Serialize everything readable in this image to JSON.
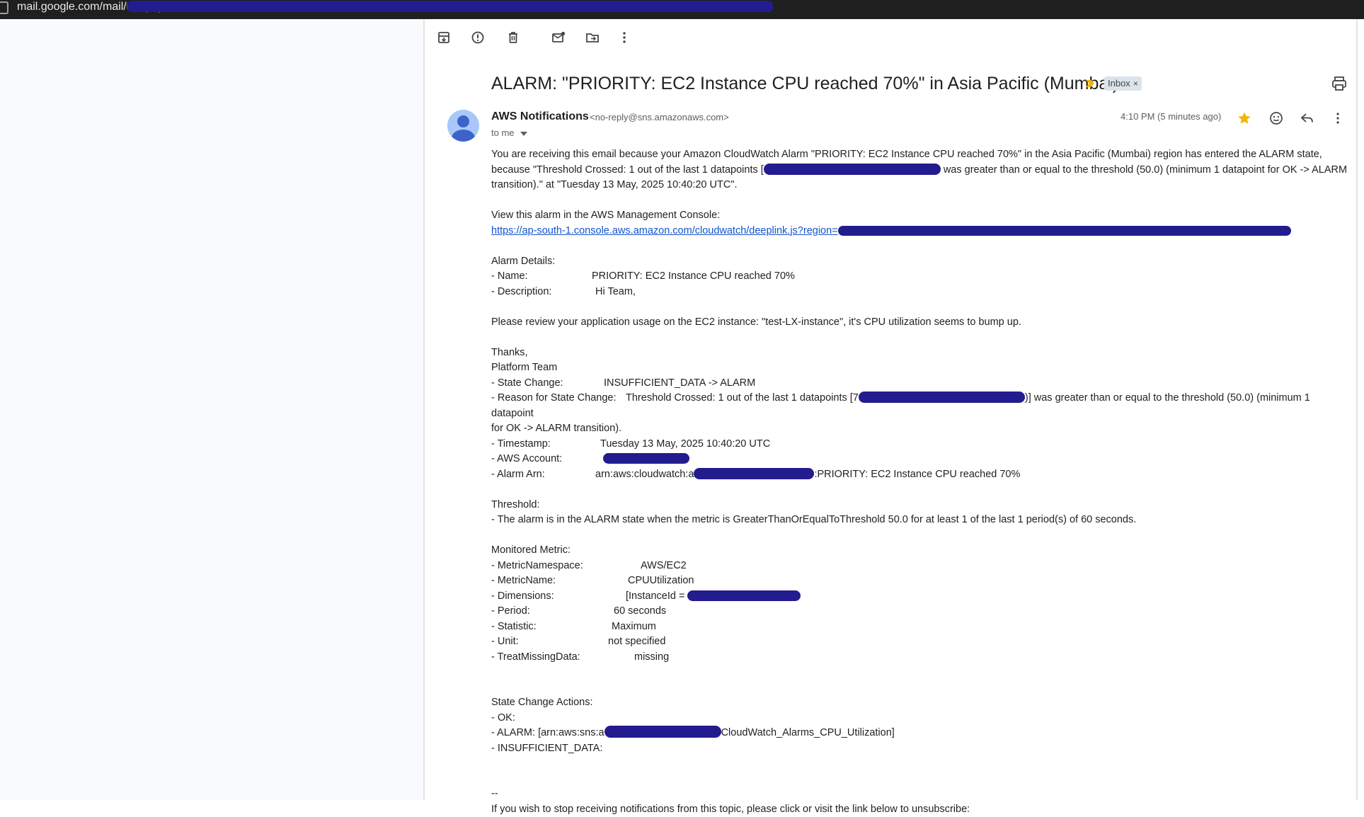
{
  "browser": {
    "url": "mail.google.com/mail/u/0/popout?ver=..."
  },
  "toolbar": {
    "archive": "archive-icon",
    "spam": "report-spam-icon",
    "delete": "delete-icon",
    "mark_unread": "mark-unread-icon",
    "move": "move-to-icon",
    "more": "more-vert-icon"
  },
  "email": {
    "subject": "ALARM: \"PRIORITY: EC2 Instance CPU reached 70%\" in Asia Pacific (Mumbai)",
    "label": "Inbox",
    "label_close": "×",
    "sender_name": "AWS Notifications",
    "sender_email": "<no-reply@sns.amazonaws.com>",
    "to": "to me",
    "time": "4:10 PM (5 minutes ago)",
    "colors": {
      "star": "#f4b400",
      "important": "#f4b400",
      "link": "#1155cc",
      "redaction": "#231c8e"
    }
  },
  "body": {
    "intro_1": "You are receiving this email because your Amazon CloudWatch Alarm \"PRIORITY: EC2 Instance CPU reached 70%\" in the Asia Pacific (Mumbai) region has entered the ALARM state,",
    "intro_2a": "because \"Threshold Crossed: 1 out of the last 1 datapoints [",
    "intro_2b": " was greater than or equal to the threshold (50.0) (minimum 1 datapoint for OK -> ALARM",
    "intro_3": "transition).\" at \"Tuesday 13 May, 2025 10:40:20 UTC\".",
    "console_label": "View this alarm in the AWS Management Console:",
    "console_link": "https://ap-south-1.console.aws.amazon.com/cloudwatch/deeplink.js?region=",
    "details_header": "Alarm Details:",
    "name_label": "- Name:",
    "name_value": "PRIORITY: EC2 Instance CPU reached 70%",
    "desc_label": "- Description:",
    "desc_value": "Hi Team,",
    "review_line": "Please review your application usage on the EC2 instance: \"test-LX-instance\", it's CPU utilization seems to bump up.",
    "thanks": "Thanks,",
    "team": "Platform Team",
    "state_label": "- State Change:",
    "state_value": "INSUFFICIENT_DATA -> ALARM",
    "reason_label": "- Reason for State Change:",
    "reason_value_a": "Threshold Crossed: 1 out of the last 1 datapoints [7",
    "reason_value_b": ")] was greater than or equal to the threshold (50.0) (minimum 1 datapoint",
    "reason_cont": "for OK -> ALARM transition).",
    "timestamp_label": "- Timestamp:",
    "timestamp_value": "Tuesday 13 May, 2025 10:40:20 UTC",
    "account_label": "- AWS Account:",
    "arn_label": "- Alarm Arn:",
    "arn_value_a": "arn:aws:cloudwatch:a",
    "arn_value_b": ":PRIORITY: EC2 Instance CPU reached 70%",
    "threshold_header": "Threshold:",
    "threshold_line": "- The alarm is in the ALARM state when the metric is GreaterThanOrEqualToThreshold 50.0 for at least 1 of the last 1 period(s) of 60 seconds.",
    "metric_header": "Monitored Metric:",
    "ns_label": "- MetricNamespace:",
    "ns_value": "AWS/EC2",
    "mname_label": "- MetricName:",
    "mname_value": "CPUUtilization",
    "dim_label": "- Dimensions:",
    "dim_value": "[InstanceId =",
    "period_label": "- Period:",
    "period_value": "60 seconds",
    "stat_label": "- Statistic:",
    "stat_value": "Maximum",
    "unit_label": "- Unit:",
    "unit_value": "not specified",
    "tmd_label": "- TreatMissingData:",
    "tmd_value": "missing",
    "actions_header": "State Change Actions:",
    "ok_label": "- OK:",
    "alarm_label": "- ALARM: [arn:aws:sns:a",
    "alarm_value_b": "CloudWatch_Alarms_CPU_Utilization]",
    "insuff_label": "- INSUFFICIENT_DATA:",
    "sig": "--",
    "unsub": "If you wish to stop receiving notifications from this topic, please click or visit the link below to unsubscribe:"
  }
}
